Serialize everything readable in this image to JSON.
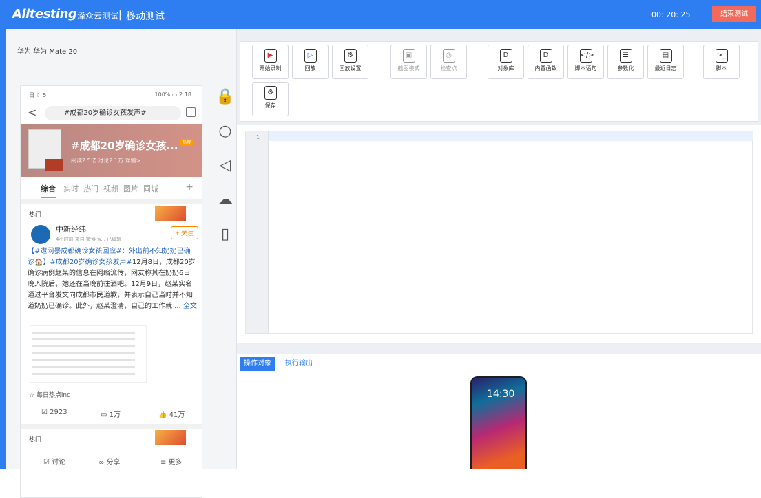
{
  "header": {
    "brand": "Alltesting",
    "brand_cn": "泽众云测试",
    "separator": "|",
    "module": "移动测试",
    "timer": "00: 20: 25",
    "end_button": "结束测试"
  },
  "device": {
    "label": "华为 华为 Mate 20",
    "status_left": "日 ☾ 5",
    "status_right": "100% ▭ 2:18"
  },
  "search": {
    "query": "#成都20岁确诊女孩发声#"
  },
  "banner": {
    "title": "#成都20岁确诊女孩...",
    "stats": "阅读2.5亿 讨论2.1万 详情>",
    "badge": "热搜"
  },
  "tabs": {
    "items": [
      "综合",
      "实时",
      "热门",
      "视频",
      "图片",
      "同城"
    ],
    "plus": "+"
  },
  "post": {
    "section": "热门",
    "name": "中新经纬",
    "meta": "4小时前 来自 微博 w... 已编辑",
    "follow": "+ 关注",
    "text_link": "【#遭网暴成都确诊女孩回应#：外出前不知奶奶已确诊🏠】#成都20岁确诊女孩发声#",
    "text": "12月8日，成都20岁确诊病例赵某的信息在网络流传，网友称其在奶奶6日晚入院后，她还在当晚前往酒吧。12月9日，赵某实名通过平台发文向成都市民道歉，并表示自己当时并不知道奶奶已确诊。此外，赵某澄清，自己的工作就 ... ",
    "more": "全文",
    "hot_label": "☆ 每日热点ing",
    "reposts": "☑ 2923",
    "comments": "▭ 1万",
    "likes": "👍 41万"
  },
  "next_post": {
    "section": "热门"
  },
  "bottom_bar": {
    "discuss": "☑ 讨论",
    "share": "∞ 分享",
    "more": "≡ 更多"
  },
  "toolbar": [
    {
      "label": "开始录制",
      "icon": "▶"
    },
    {
      "label": "回放",
      "icon": "▷"
    },
    {
      "label": "回放设置",
      "icon": "⚙"
    },
    {
      "label": "截图模式",
      "icon": "▣"
    },
    {
      "label": "检查点",
      "icon": "◎"
    },
    {
      "label": "对象库",
      "icon": "D"
    },
    {
      "label": "内置函数",
      "icon": "D"
    },
    {
      "label": "脚本语句",
      "icon": "</>"
    },
    {
      "label": "参数化",
      "icon": "☰"
    },
    {
      "label": "最近日志",
      "icon": "▤"
    },
    {
      "label": "脚本",
      "icon": ">_"
    },
    {
      "label": "保存",
      "icon": "⚙"
    }
  ],
  "editor": {
    "line_number": "1"
  },
  "output": {
    "tabs": [
      "操作对象",
      "执行输出"
    ],
    "time": "14:30"
  }
}
